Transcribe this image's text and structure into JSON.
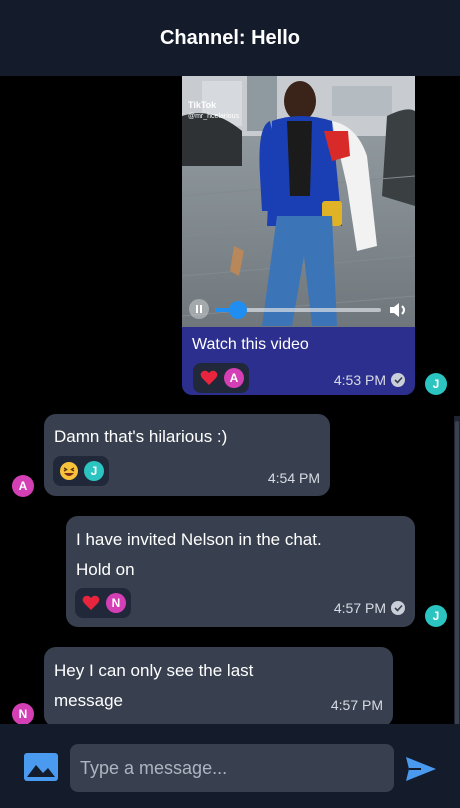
{
  "header": {
    "title": "Channel: Hello"
  },
  "colors": {
    "avatar_j": "#2cc4c0",
    "avatar_a": "#d43fb5",
    "avatar_n": "#d43fb5",
    "accent": "#4a9bf0",
    "bubble": "#384050",
    "video_bubble": "#2d2f8e"
  },
  "messages": [
    {
      "type": "video",
      "video_watermark": "TikTok",
      "video_handle": "@mr_hcelarious",
      "caption": "Watch this video",
      "reactions": [
        {
          "icon": "heart-icon"
        }
      ],
      "reactors": [
        "A"
      ],
      "time": "4:53 PM",
      "author_initial": "J",
      "progress": 0.12
    },
    {
      "type": "text",
      "text": "Damn that's hilarious :)",
      "reactions": [
        {
          "icon": "laughing-face-icon"
        }
      ],
      "reactors": [
        "J"
      ],
      "time": "4:54 PM",
      "author_initial": "A"
    },
    {
      "type": "text",
      "text": "I have invited Nelson in the chat. Hold on",
      "reactions": [
        {
          "icon": "heart-icon"
        }
      ],
      "reactors": [
        "N"
      ],
      "time": "4:57 PM",
      "author_initial": "J"
    },
    {
      "type": "text",
      "text": "Hey I can only see the last message",
      "time": "4:57 PM",
      "author_initial": "N"
    }
  ],
  "composer": {
    "placeholder": "Type a message..."
  }
}
